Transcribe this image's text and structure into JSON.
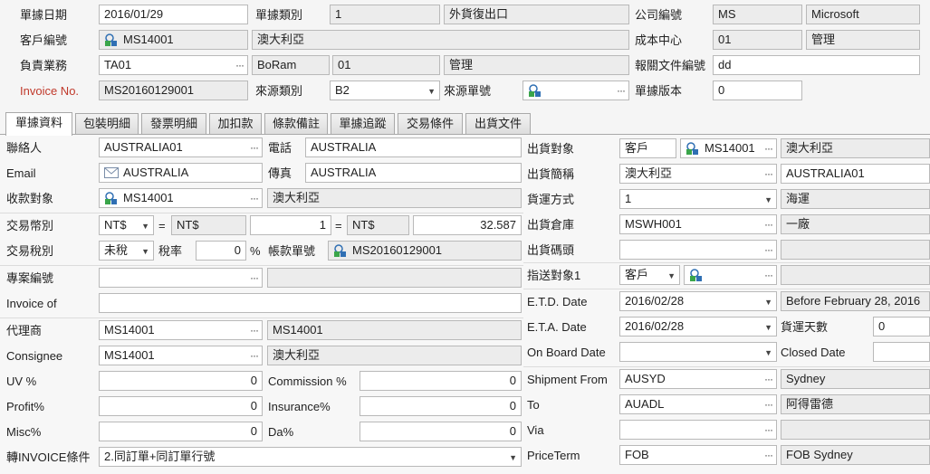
{
  "header": {
    "doc_date_label": "單據日期",
    "doc_date": "2016/01/29",
    "doc_type_label": "單據類別",
    "doc_type": "1",
    "doc_type_desc": "外貨復出口",
    "company_label": "公司編號",
    "company_code": "MS",
    "company_name": "Microsoft",
    "customer_label": "客戶編號",
    "customer_code": "MS14001",
    "customer_name": "澳大利亞",
    "cost_center_label": "成本中心",
    "cost_center_code": "01",
    "cost_center_name": "管理",
    "sales_label": "負責業務",
    "sales_code": "TA01",
    "sales_name": "BoRam",
    "sales_dept_code": "01",
    "sales_dept_name": "管理",
    "customs_doc_label": "報關文件編號",
    "customs_doc": "dd",
    "invoice_label": "Invoice No.",
    "invoice_no": "MS20160129001",
    "source_type_label": "來源類別",
    "source_type": "B2",
    "source_no_label": "來源單號",
    "source_no": "",
    "version_label": "單據版本",
    "version": "0"
  },
  "tabs": [
    "單據資料",
    "包裝明細",
    "發票明細",
    "加扣款",
    "條款備註",
    "單據追蹤",
    "交易條件",
    "出貨文件"
  ],
  "left": {
    "contact_label": "聯絡人",
    "contact": "AUSTRALIA01",
    "phone_label": "電話",
    "phone": "AUSTRALIA",
    "email_label": "Email",
    "email": "AUSTRALIA",
    "fax_label": "傳真",
    "fax": "AUSTRALIA",
    "payee_label": "收款對象",
    "payee_code": "MS14001",
    "payee_name": "澳大利亞",
    "currency_label": "交易幣別",
    "currency": "NT$",
    "eq1": "=",
    "currency_b": "NT$",
    "rate_a": "1",
    "eq2": "=",
    "currency_c": "NT$",
    "rate_b": "32.587",
    "tax_label": "交易稅別",
    "tax_type": "未稅",
    "tax_rate_label": "稅率",
    "tax_rate": "0",
    "pct": "%",
    "ar_doc_label": "帳款單號",
    "ar_doc": "MS20160129001",
    "project_label": "專案編號",
    "project_code": "",
    "project_name": "",
    "invoice_of_label": "Invoice  of",
    "invoice_of": "",
    "agent_label": "代理商",
    "agent_code": "MS14001",
    "agent_name": "MS14001",
    "consignee_label": "Consignee",
    "consignee_code": "MS14001",
    "consignee_name": "澳大利亞",
    "uv_label": "UV %",
    "uv": "0",
    "commission_label": "Commission %",
    "commission": "0",
    "profit_label": "Profit%",
    "profit": "0",
    "insurance_label": "Insurance%",
    "insurance": "0",
    "misc_label": "Misc%",
    "misc": "0",
    "da_label": "Da%",
    "da": "0",
    "convert_label": "轉INVOICE條件",
    "convert": "2.同訂單+同訂單行號"
  },
  "right": {
    "ship_to_label": "出貨對象",
    "ship_to_type": "客戶",
    "ship_to_code": "MS14001",
    "ship_to_name": "澳大利亞",
    "ship_abbr_label": "出貨簡稱",
    "ship_abbr": "澳大利亞",
    "ship_abbr_contact": "AUSTRALIA01",
    "transport_label": "貨運方式",
    "transport_code": "1",
    "transport_name": "海運",
    "warehouse_label": "出貨倉庫",
    "warehouse_code": "MSWH001",
    "warehouse_name": "一廠",
    "wharf_label": "出貨碼頭",
    "wharf_code": "",
    "wharf_name": "",
    "notify_label": "指送對象1",
    "notify_type": "客戶",
    "notify_code": "",
    "notify_name": "",
    "etd_label": "E.T.D. Date",
    "etd": "2016/02/28",
    "etd_text": "Before February 28, 2016",
    "eta_label": "E.T.A. Date",
    "eta": "2016/02/28",
    "transit_days_label": "貨運天數",
    "transit_days": "0",
    "onboard_label": "On Board Date",
    "onboard": "",
    "closed_label": "Closed Date",
    "closed": "",
    "ship_from_label": "Shipment From",
    "ship_from_code": "AUSYD",
    "ship_from_name": "Sydney",
    "to_label": "To",
    "to_code": "AUADL",
    "to_name": "阿得雷德",
    "via_label": "Via",
    "via_code": "",
    "via_name": "",
    "price_term_label": "PriceTerm",
    "price_term_code": "FOB",
    "price_term_name": "FOB Sydney"
  }
}
